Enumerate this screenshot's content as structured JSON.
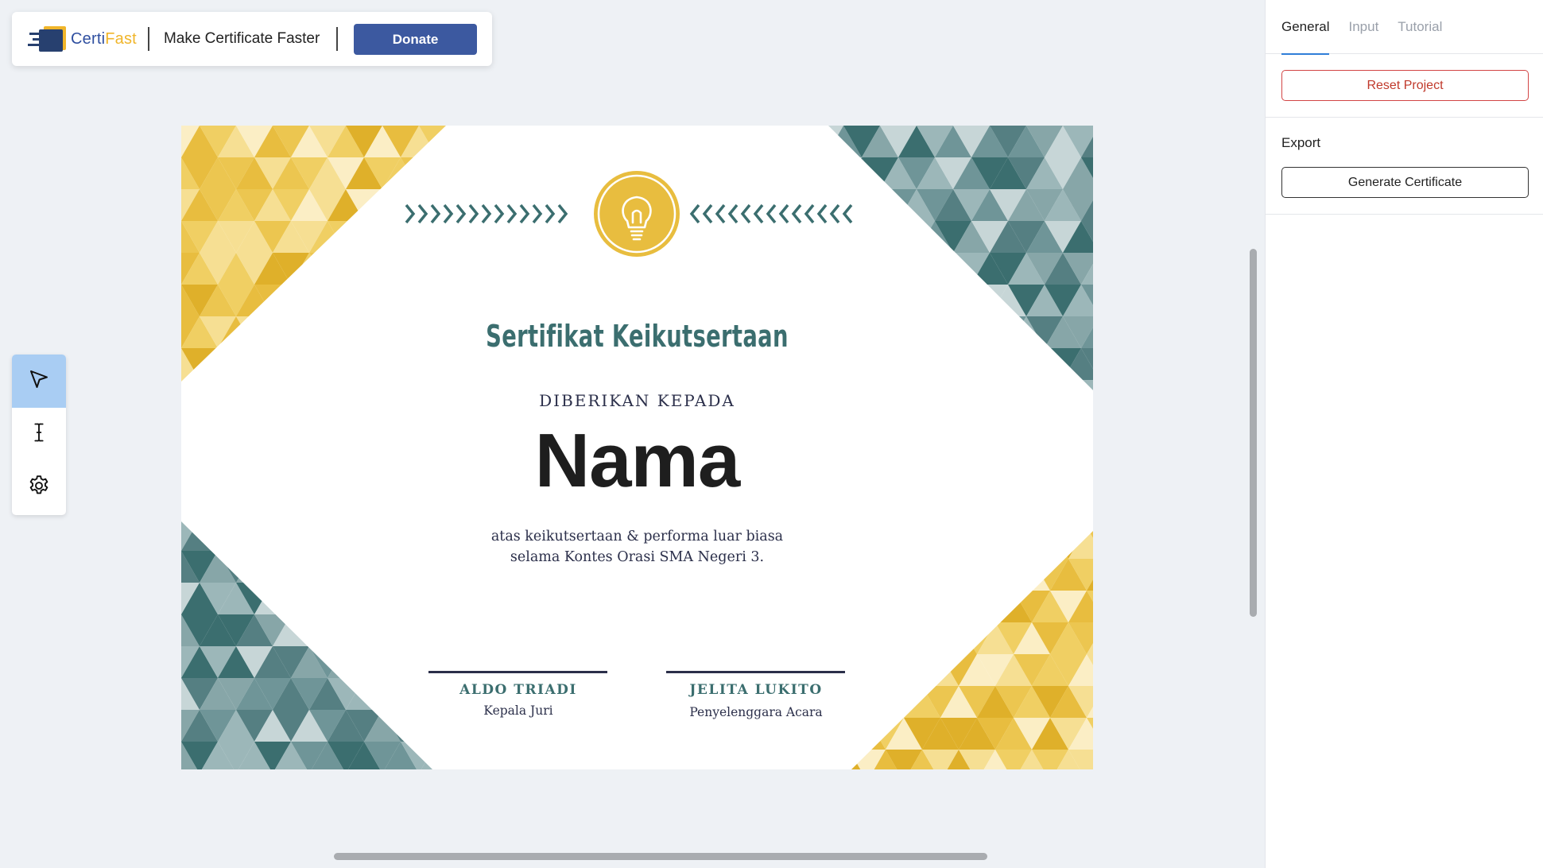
{
  "header": {
    "logo_part1": "Certi",
    "logo_part2": "Fast",
    "tagline": "Make Certificate Faster",
    "donate_label": "Donate"
  },
  "tools": [
    {
      "name": "select",
      "icon": "cursor-arrow-icon",
      "active": true
    },
    {
      "name": "text",
      "icon": "text-cursor-icon",
      "active": false
    },
    {
      "name": "settings",
      "icon": "gear-icon",
      "active": false
    }
  ],
  "certificate": {
    "title": "Sertifikat Keikutsertaan",
    "given_to": "DIBERIKAN KEPADA",
    "name": "Nama",
    "description_line1": "atas keikutsertaan & performa luar biasa",
    "description_line2": "selama Kontes Orasi SMA Negeri 3.",
    "signatures": [
      {
        "name": "ALDO TRIADI",
        "role": "Kepala Juri"
      },
      {
        "name": "JELITA LUKITO",
        "role": "Penyelenggara Acara"
      }
    ],
    "emblem_icon": "lightbulb-icon",
    "colors": {
      "gold": "#e8bd3f",
      "teal": "#3b6e6f",
      "navy": "#2b2f4a"
    }
  },
  "panel": {
    "tabs": [
      {
        "label": "General",
        "active": true
      },
      {
        "label": "Input",
        "active": false
      },
      {
        "label": "Tutorial",
        "active": false
      }
    ],
    "reset_label": "Reset Project",
    "export_label": "Export",
    "generate_label": "Generate Certificate"
  }
}
